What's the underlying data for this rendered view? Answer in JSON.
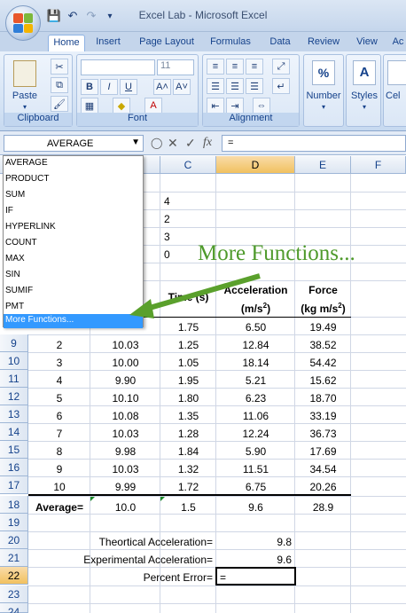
{
  "window": {
    "title": "Excel Lab - Microsoft Excel"
  },
  "qat": {
    "save": "💾",
    "undo": "↶",
    "redo": "↷",
    "more": "▾"
  },
  "tabs": [
    "Home",
    "Insert",
    "Page Layout",
    "Formulas",
    "Data",
    "Review",
    "View",
    "Ac"
  ],
  "active_tab": "Home",
  "ribbon": {
    "clipboard": {
      "label": "Clipboard",
      "paste": "Paste"
    },
    "font": {
      "label": "Font",
      "font_name": "",
      "font_size": "11",
      "bold": "B",
      "italic": "I",
      "underline": "U"
    },
    "alignment": {
      "label": "Alignment"
    },
    "number": {
      "label": "Number",
      "symbol": "%"
    },
    "styles": {
      "label": "Styles",
      "symbol": "A"
    },
    "cells": {
      "label": "Cel"
    }
  },
  "formula_bar": {
    "name_box": "AVERAGE",
    "formula": "="
  },
  "columns": [
    "C",
    "D",
    "E",
    "F"
  ],
  "selected_column": "D",
  "rows": [
    "9",
    "10",
    "11",
    "12",
    "13",
    "14",
    "15",
    "16",
    "17",
    "18",
    "19",
    "20",
    "21",
    "22",
    "23",
    "24"
  ],
  "selected_row": "22",
  "table_header": {
    "time": "Time (s)",
    "acceleration_1": "Acceleration",
    "acceleration_2": "(m/s",
    "acceleration_sup": "2",
    "acceleration_close": ")",
    "force_1": "Force",
    "force_2": "(kg m/s",
    "force_sup": "2",
    "force_close": ")"
  },
  "upper_values": [
    "4",
    "2",
    "3",
    "0"
  ],
  "first_data_row": {
    "time": "1.75",
    "acceleration": "6.50",
    "force": "19.49"
  },
  "data_rows": [
    {
      "trial": "2",
      "mass": "10.03",
      "time": "1.25",
      "acceleration": "12.84",
      "force": "38.52"
    },
    {
      "trial": "3",
      "mass": "10.00",
      "time": "1.05",
      "acceleration": "18.14",
      "force": "54.42"
    },
    {
      "trial": "4",
      "mass": "9.90",
      "time": "1.95",
      "acceleration": "5.21",
      "force": "15.62"
    },
    {
      "trial": "5",
      "mass": "10.10",
      "time": "1.80",
      "acceleration": "6.23",
      "force": "18.70"
    },
    {
      "trial": "6",
      "mass": "10.08",
      "time": "1.35",
      "acceleration": "11.06",
      "force": "33.19"
    },
    {
      "trial": "7",
      "mass": "10.03",
      "time": "1.28",
      "acceleration": "12.24",
      "force": "36.73"
    },
    {
      "trial": "8",
      "mass": "9.98",
      "time": "1.84",
      "acceleration": "5.90",
      "force": "17.69"
    },
    {
      "trial": "9",
      "mass": "10.03",
      "time": "1.32",
      "acceleration": "11.51",
      "force": "34.54"
    },
    {
      "trial": "10",
      "mass": "9.99",
      "time": "1.72",
      "acceleration": "6.75",
      "force": "20.26"
    }
  ],
  "average_row": {
    "label": "Average=",
    "mass": "10.0",
    "time": "1.5",
    "acceleration": "9.6",
    "force": "28.9"
  },
  "summary": {
    "theoretical_label": "Theortical Acceleration=",
    "theoretical_value": "9.8",
    "experimental_label": "Experimental Acceleration=",
    "experimental_value": "9.6",
    "percent_label": "Percent Error=",
    "percent_value": "="
  },
  "function_dropdown": {
    "items": [
      "AVERAGE",
      "PRODUCT",
      "SUM",
      "IF",
      "HYPERLINK",
      "COUNT",
      "MAX",
      "SIN",
      "SUMIF",
      "PMT",
      "More Functions..."
    ],
    "selected_index": 10
  },
  "annotation": {
    "text": "More Functions...",
    "color": "#4e9a2b"
  }
}
